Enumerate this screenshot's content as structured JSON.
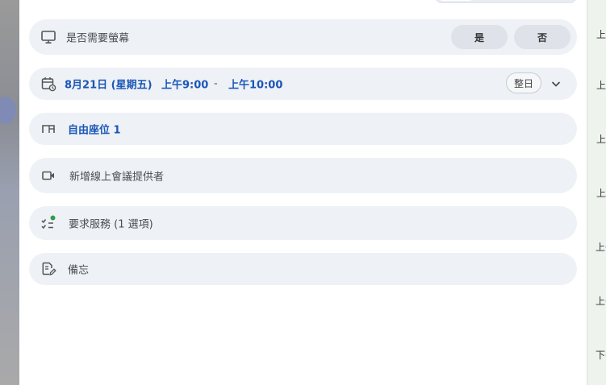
{
  "backdrop": {
    "right_labels": [
      "上",
      "上",
      "上",
      "上",
      "上午",
      "上午",
      "下午"
    ]
  },
  "form": {
    "screen_question": {
      "label": "是否需要螢幕",
      "yes_label": "是",
      "no_label": "否"
    },
    "schedule": {
      "date": "8月21日 (星期五)",
      "start_time": "上午9:00",
      "separator": "-",
      "end_time": "上午10:00",
      "all_day_label": "整日"
    },
    "seat": {
      "label": "自由座位 1"
    },
    "conference": {
      "label": "新增線上會議提供者"
    },
    "services": {
      "label": "要求服務 (1 選項)"
    },
    "notes": {
      "label": "備忘"
    }
  },
  "colors": {
    "accent": "#1a56b8",
    "row_bg": "#eef1f5",
    "badge_dot": "#2e9e4a"
  }
}
